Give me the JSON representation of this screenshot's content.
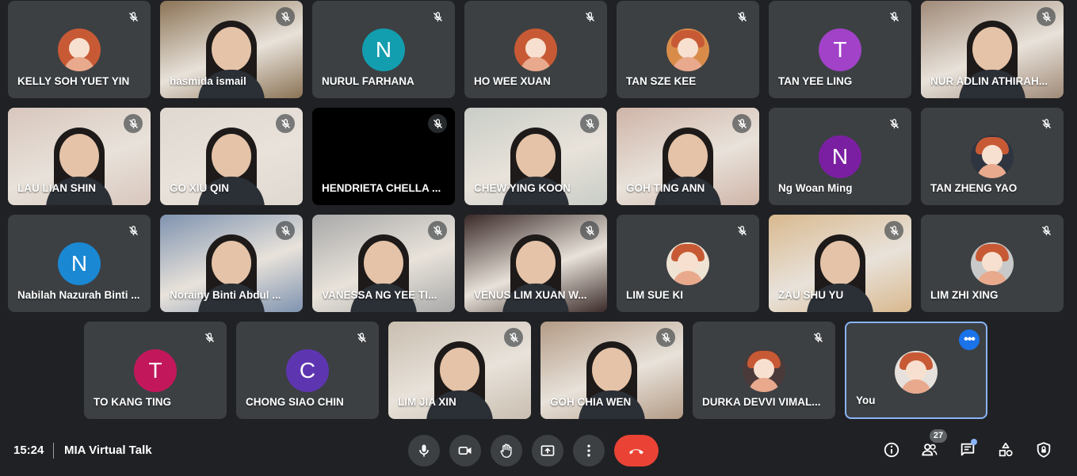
{
  "participants": [
    {
      "name": "KELLY SOH YUET YIN",
      "kind": "pic",
      "color": "#c75a35"
    },
    {
      "name": "hasmida ismail",
      "kind": "video",
      "scene": "#8b7355"
    },
    {
      "name": "NURUL FARHANA",
      "kind": "letter",
      "initial": "N",
      "color": "#129eaf"
    },
    {
      "name": "HO WEE XUAN",
      "kind": "pic",
      "color": "#c75a35"
    },
    {
      "name": "TAN SZE KEE",
      "kind": "pic",
      "color": "#d98c4a"
    },
    {
      "name": "TAN YEE LING",
      "kind": "letter",
      "initial": "T",
      "color": "#a142c8"
    },
    {
      "name": "NUR ADLIN ATHIRAH...",
      "kind": "video",
      "scene": "#a08a78"
    },
    {
      "name": "LAU LIAN SHIN",
      "kind": "video",
      "scene": "#d8c6bd"
    },
    {
      "name": "GO XIU QIN",
      "kind": "video",
      "scene": "#ded8d0"
    },
    {
      "name": "HENDRIETA CHELLA ...",
      "kind": "black"
    },
    {
      "name": "CHEW YING KOON",
      "kind": "video",
      "scene": "#c9cdc7"
    },
    {
      "name": "GOH TING ANN",
      "kind": "video",
      "scene": "#cfb4a8"
    },
    {
      "name": "Ng Woan Ming",
      "kind": "letter",
      "initial": "N",
      "color": "#7b1fa2"
    },
    {
      "name": "TAN ZHENG YAO",
      "kind": "pic",
      "color": "#2f3540"
    },
    {
      "name": "Nabilah Nazurah Binti ...",
      "kind": "letter",
      "initial": "N",
      "color": "#1a88d3"
    },
    {
      "name": "Norainy Binti Abdul ...",
      "kind": "video",
      "scene": "#7f93b0"
    },
    {
      "name": "VANESSA NG YEE TI...",
      "kind": "video",
      "scene": "#a9a9a9"
    },
    {
      "name": "VENUS LIM XUAN W...",
      "kind": "video",
      "scene": "#3a2a28"
    },
    {
      "name": "LIM SUE KI",
      "kind": "pic",
      "color": "#efe3d3"
    },
    {
      "name": "ZAU SHU YU",
      "kind": "video",
      "scene": "#d9b98f"
    },
    {
      "name": "LIM ZHI XING",
      "kind": "pic",
      "color": "#c9c9c9"
    },
    {
      "name": "TO KANG TING",
      "kind": "letter",
      "initial": "T",
      "color": "#c2185b"
    },
    {
      "name": "CHONG SIAO CHIN",
      "kind": "letter",
      "initial": "C",
      "color": "#5e35b1"
    },
    {
      "name": "LIM JIA XIN",
      "kind": "video",
      "scene": "#c9beb0"
    },
    {
      "name": "GOH CHIA WEN",
      "kind": "video",
      "scene": "#b39b86"
    },
    {
      "name": "DURKA DEVVI VIMAL...",
      "kind": "pic",
      "color": "#4a3a3a"
    },
    {
      "name": "You",
      "kind": "pic",
      "color": "#e6e1dc",
      "self": true
    }
  ],
  "footer": {
    "time": "15:24",
    "title": "MIA Virtual Talk",
    "people_count": "27",
    "icons": {
      "mic": "microphone-icon",
      "cam": "camera-icon",
      "hand": "raise-hand-icon",
      "present": "present-screen-icon",
      "more": "more-options-icon",
      "leave": "leave-call-icon",
      "info": "info-icon",
      "people": "people-icon",
      "chat": "chat-icon",
      "activities": "activities-icon",
      "safety": "host-controls-icon"
    }
  },
  "colors": {
    "background": "#202124",
    "tile": "#3c4043",
    "leave": "#ea4335",
    "accent": "#8ab4f8"
  }
}
